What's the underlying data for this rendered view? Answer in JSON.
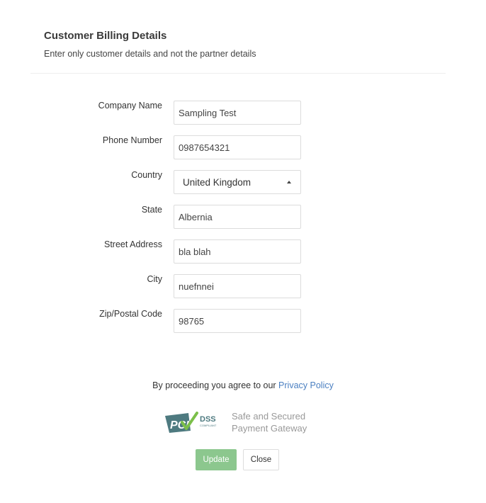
{
  "header": {
    "title": "Customer Billing Details",
    "subtitle": "Enter only customer details and not the partner details"
  },
  "form": {
    "company_name": {
      "label": "Company Name",
      "value": "Sampling Test"
    },
    "phone_number": {
      "label": "Phone Number",
      "value": "0987654321"
    },
    "country": {
      "label": "Country",
      "value": "United Kingdom"
    },
    "state": {
      "label": "State",
      "value": "Albernia"
    },
    "street_address": {
      "label": "Street Address",
      "value": "bla blah"
    },
    "city": {
      "label": "City",
      "value": "nuefnnei"
    },
    "zip": {
      "label": "Zip/Postal Code",
      "value": "98765"
    }
  },
  "footer": {
    "agree_text": "By proceeding you agree to our",
    "privacy_link": "Privacy Policy",
    "secure_line1": "Safe and Secured",
    "secure_line2": "Payment Gateway",
    "pci_logo_text": "PCI DSS COMPLIANT"
  },
  "buttons": {
    "update": "Update",
    "close": "Close"
  },
  "colors": {
    "update_button": "#8cc78e",
    "link": "#4a7fc1",
    "pci_logo": "#4e7a80",
    "pci_check": "#7bbf4a"
  }
}
